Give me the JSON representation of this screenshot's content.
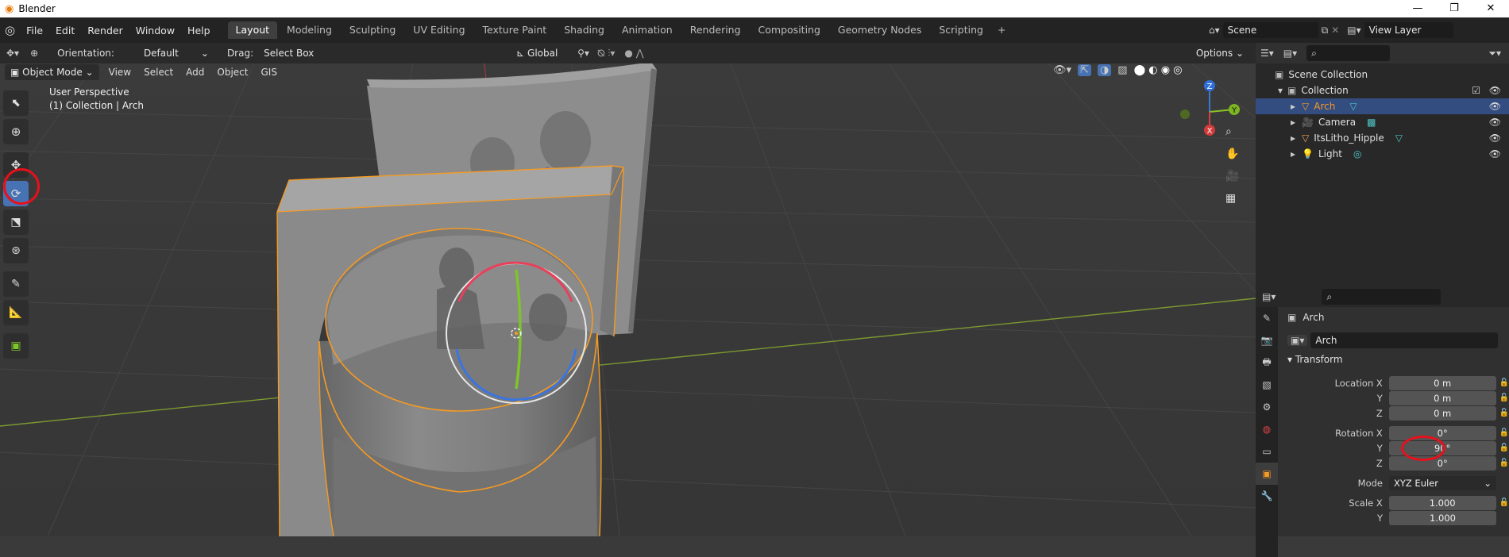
{
  "window": {
    "title": "Blender",
    "controls": [
      "—",
      "❐",
      "✕"
    ]
  },
  "menu": [
    "File",
    "Edit",
    "Render",
    "Window",
    "Help"
  ],
  "workspace_tabs": [
    {
      "label": "Layout",
      "active": true
    },
    {
      "label": "Modeling"
    },
    {
      "label": "Sculpting"
    },
    {
      "label": "UV Editing"
    },
    {
      "label": "Texture Paint"
    },
    {
      "label": "Shading"
    },
    {
      "label": "Animation"
    },
    {
      "label": "Rendering"
    },
    {
      "label": "Compositing"
    },
    {
      "label": "Geometry Nodes"
    },
    {
      "label": "Scripting"
    },
    {
      "label": "+"
    }
  ],
  "scene": {
    "name": "Scene",
    "view_layer": "View Layer"
  },
  "tool_header": {
    "orientation_label": "Orientation:",
    "orientation_value": "Default",
    "drag_label": "Drag:",
    "drag_value": "Select Box",
    "transform_orientation": "Global",
    "options": "Options"
  },
  "viewport_header": {
    "mode": "Object Mode",
    "menus": [
      "View",
      "Select",
      "Add",
      "Object",
      "GIS"
    ]
  },
  "viewport_overlay": {
    "line1": "User Perspective",
    "line2": "(1) Collection | Arch"
  },
  "gizmo": {
    "z": "Z",
    "y": "Y",
    "x": "X"
  },
  "outliner": {
    "root": "Scene Collection",
    "collection": "Collection",
    "items": [
      {
        "name": "Arch",
        "selected": true
      },
      {
        "name": "Camera"
      },
      {
        "name": "ItsLitho_Hipple"
      },
      {
        "name": "Light"
      }
    ]
  },
  "properties": {
    "object_name": "Arch",
    "object_field": "Arch",
    "section": "Transform",
    "location": {
      "label": "Location X",
      "x": "0 m",
      "y": "0 m",
      "z": "0 m"
    },
    "rotation": {
      "label": "Rotation X",
      "x": "0°",
      "y": "90°",
      "z": "0°"
    },
    "mode_label": "Mode",
    "mode_value": "XYZ Euler",
    "scale": {
      "label": "Scale X",
      "x": "1.000",
      "y": "1.000"
    },
    "axis_labels": {
      "y": "Y",
      "z": "Z"
    }
  },
  "colors": {
    "selection_orange": "#f59a23",
    "active_blue": "#4772b3",
    "annotation_red": "#e8101a"
  }
}
